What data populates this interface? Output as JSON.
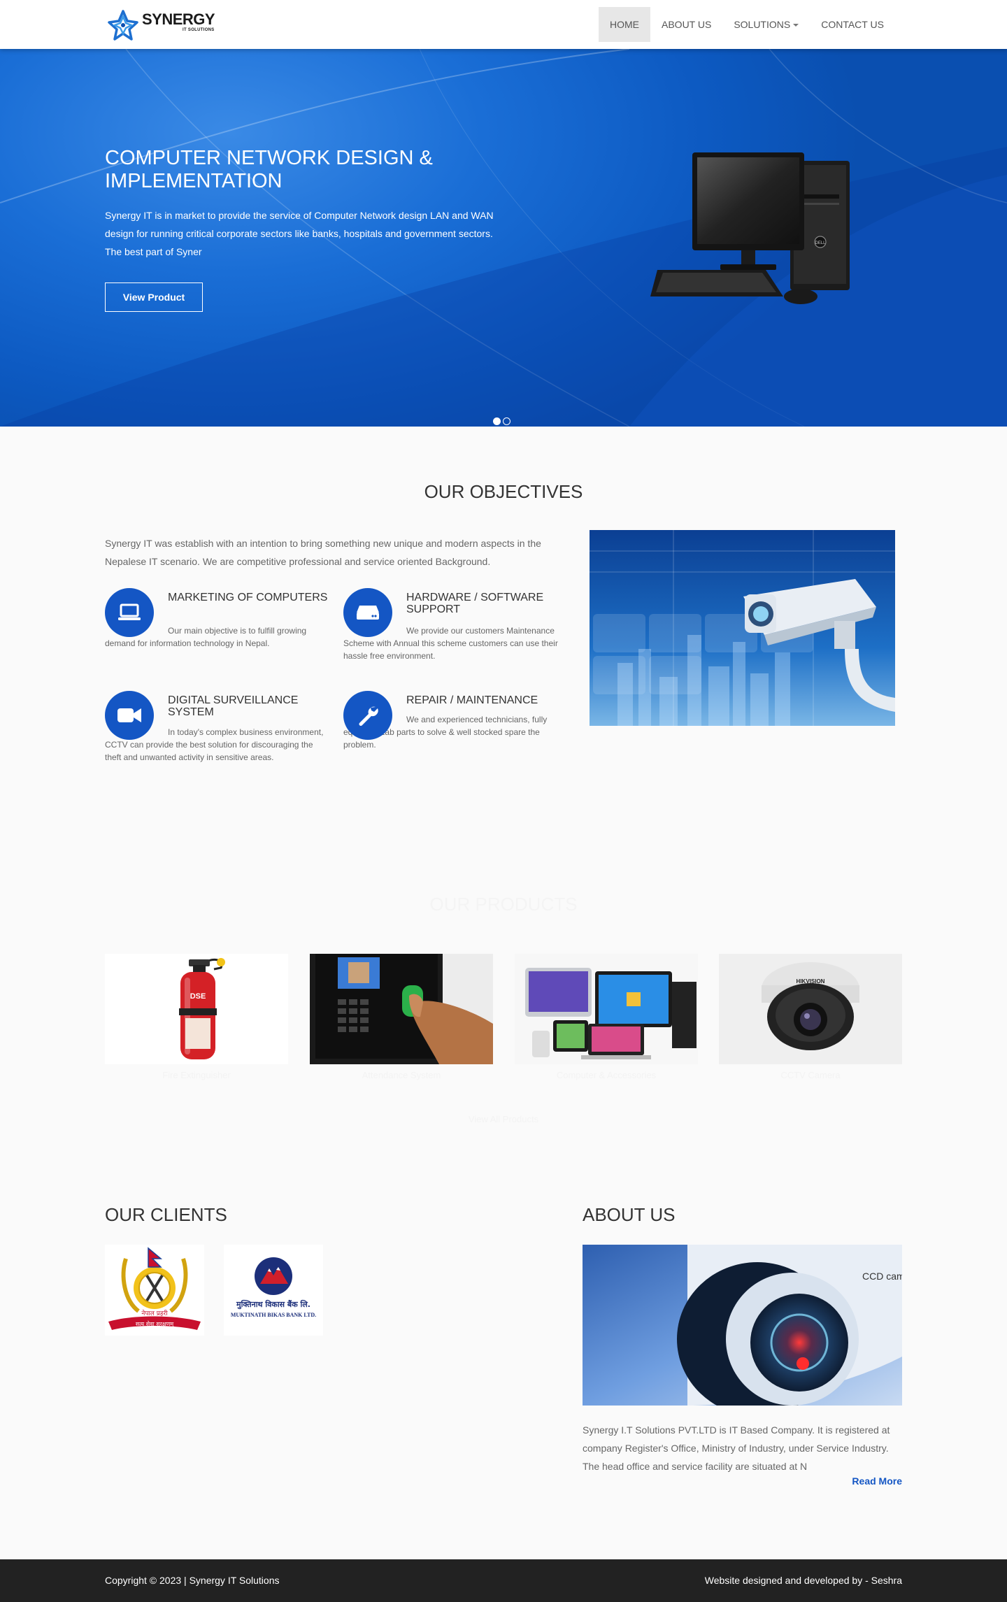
{
  "brand": {
    "name": "SYNERGY",
    "tagline": "IT SOLUTIONS"
  },
  "nav": {
    "items": [
      {
        "label": "HOME",
        "active": true
      },
      {
        "label": "ABOUT US",
        "active": false
      },
      {
        "label": "SOLUTIONS",
        "active": false,
        "has_dropdown": true
      },
      {
        "label": "CONTACT US",
        "active": false
      }
    ]
  },
  "hero": {
    "title": "COMPUTER NETWORK DESIGN & IMPLEMENTATION",
    "text": "Synergy IT is in market to provide the service of Computer Network design LAN and WAN design for running critical corporate sectors like banks, hospitals and government sectors. The best part of Syner",
    "button_label": "View Product",
    "slides": [
      {
        "active": true
      },
      {
        "active": false
      }
    ],
    "colors": {
      "background": "#1565d0"
    }
  },
  "objectives": {
    "title": "OUR OBJECTIVES",
    "intro": "Synergy IT was establish with an intention to bring something new unique and modern aspects in the Nepalese IT scenario. We are competitive professional and service oriented Background.",
    "features": [
      {
        "icon": "laptop-icon",
        "title": "MARKETING OF COMPUTERS",
        "text": "Our main objective is to fulfill growing demand for information technology in Nepal."
      },
      {
        "icon": "hard-drive-icon",
        "title": "HARDWARE / SOFTWARE SUPPORT",
        "text": "We provide our customers Maintenance Scheme with Annual this scheme customers can use their hassle free environment."
      },
      {
        "icon": "video-camera-icon",
        "title": "DIGITAL SURVEILLANCE SYSTEM",
        "text": "In today's complex business environment, CCTV can provide the best solution for discouraging the theft and unwanted activity in sensitive areas."
      },
      {
        "icon": "wrench-icon",
        "title": "REPAIR / MAINTENANCE",
        "text": "We and experienced technicians, fully equipped Lab parts to solve & well stocked spare the problem."
      }
    ]
  },
  "products": {
    "title": "OUR PRODUCTS",
    "items": [
      {
        "image": "fire-extinguisher",
        "caption": "Fire Extinguisher"
      },
      {
        "image": "attendance-machine",
        "caption": "Attendance System"
      },
      {
        "image": "computer-devices",
        "caption": "Computer & Accessories"
      },
      {
        "image": "dome-camera",
        "caption": "CCTV Camera"
      }
    ],
    "more_label": "View All Products"
  },
  "clients": {
    "title": "OUR CLIENTS",
    "logos": [
      {
        "name": "nepal-police-logo",
        "motto": "सत्य सेवा सुरक्षणम्",
        "org": "नेपाल प्रहरी"
      },
      {
        "name": "muktinath-bank-logo",
        "line1": "मुक्तिनाथ विकास बैंक लि.",
        "line2": "MUKTINATH BIKAS BANK LTD."
      }
    ]
  },
  "about": {
    "title": "ABOUT US",
    "text": "Synergy I.T Solutions PVT.LTD is IT Based Company. It is registered at company Register's Office, Ministry of Industry, under Service Industry. The head office and service facility are situated at N",
    "read_more": "Read More"
  },
  "footer": {
    "copyright": "Copyright © 2023 | Synergy IT Solutions",
    "credit": "Website designed and developed by - Seshra"
  }
}
